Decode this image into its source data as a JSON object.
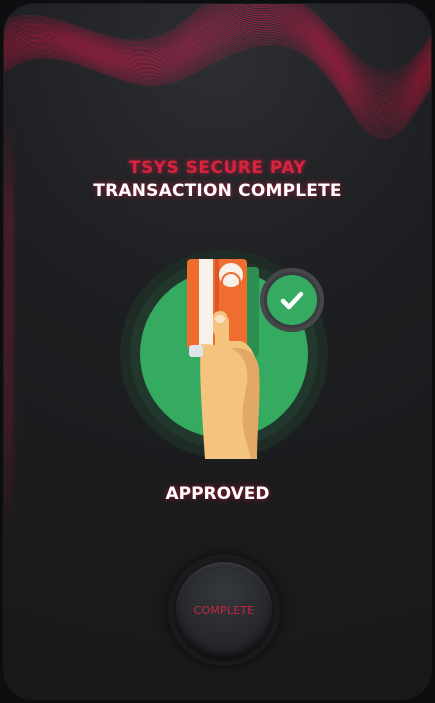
{
  "header": {
    "brand": "TSYS SECURE PAY",
    "title": "TRANSACTION COMPLETE"
  },
  "result": {
    "status": "APPROVED",
    "icon": "credit-card-tap-with-check"
  },
  "actions": {
    "complete_label": "COMPLETE"
  },
  "colors": {
    "accent": "#d6243f",
    "success_green": "#35aa61",
    "card_orange": "#ef6d2f",
    "background": "#1d1f22"
  }
}
